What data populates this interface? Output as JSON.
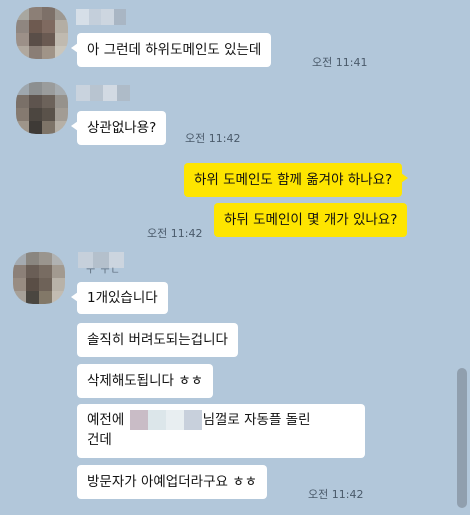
{
  "messages": [
    {
      "text": "아 그런데 하위도메인도 있는데",
      "time": "오전 11:41"
    },
    {
      "text": "상관없나용?",
      "time": "오전 11:42"
    },
    {
      "text": "하위 도메인도 함께 옮겨야 하나요?"
    },
    {
      "text": "하뒤 도메인이 몇 개가 있나요?",
      "time": "오전 11:42"
    },
    {
      "text": "1개있습니다"
    },
    {
      "text": "솔직히 버려도되는겁니다"
    },
    {
      "text": "삭제해도됩니다 ㅎㅎ"
    },
    {
      "text_before": "예전에",
      "text_after": "님껄로 자동플 돌린",
      "text_line2": "건데"
    },
    {
      "text": "방문자가 아예업더라구요 ㅎㅎ",
      "time": "오전 11:42"
    }
  ],
  "name_fragment": "ㅜ ㅜㄴ",
  "colors": {
    "background": "#b2c7da",
    "incoming_bubble": "#ffffff",
    "outgoing_bubble": "#fee500",
    "time_text": "#4a5a6a"
  }
}
